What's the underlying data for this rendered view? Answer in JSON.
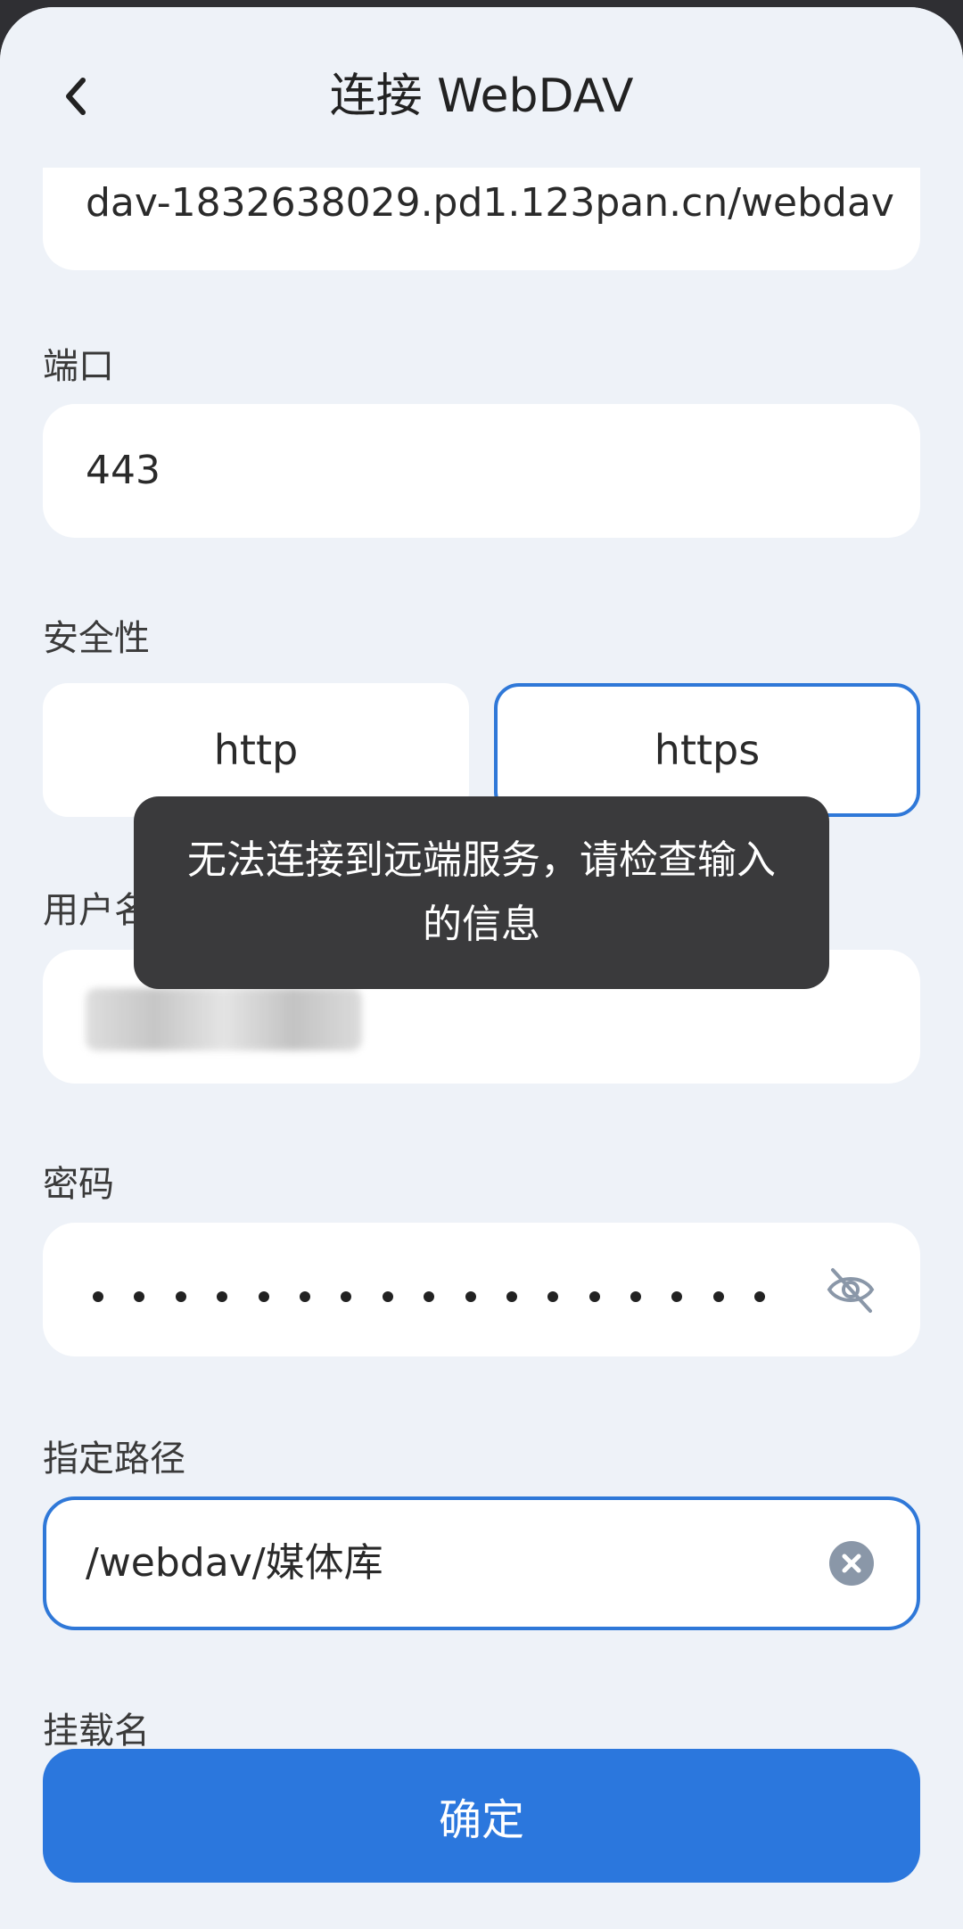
{
  "header": {
    "title": "连接 WebDAV"
  },
  "server": {
    "value": "dav-1832638029.pd1.123pan.cn/webdav"
  },
  "port": {
    "label": "端口",
    "value": "443"
  },
  "security": {
    "label": "安全性",
    "options": [
      "http",
      "https"
    ],
    "selected": "https"
  },
  "username": {
    "label": "用户名"
  },
  "password": {
    "label": "密码",
    "masked_length": 17
  },
  "path": {
    "label": "指定路径",
    "value": "/webdav/媒体库"
  },
  "mount": {
    "label": "挂载名"
  },
  "toast": {
    "message": "无法连接到远端服务，请检查输入的信息"
  },
  "confirm": {
    "label": "确定"
  },
  "colors": {
    "accent": "#2b77dd",
    "background": "#eef2f8",
    "toast_bg": "#3a3a3c"
  },
  "icons": {
    "back": "chevron-left-icon",
    "visibility": "eye-off-icon",
    "clear": "clear-circle-icon"
  }
}
